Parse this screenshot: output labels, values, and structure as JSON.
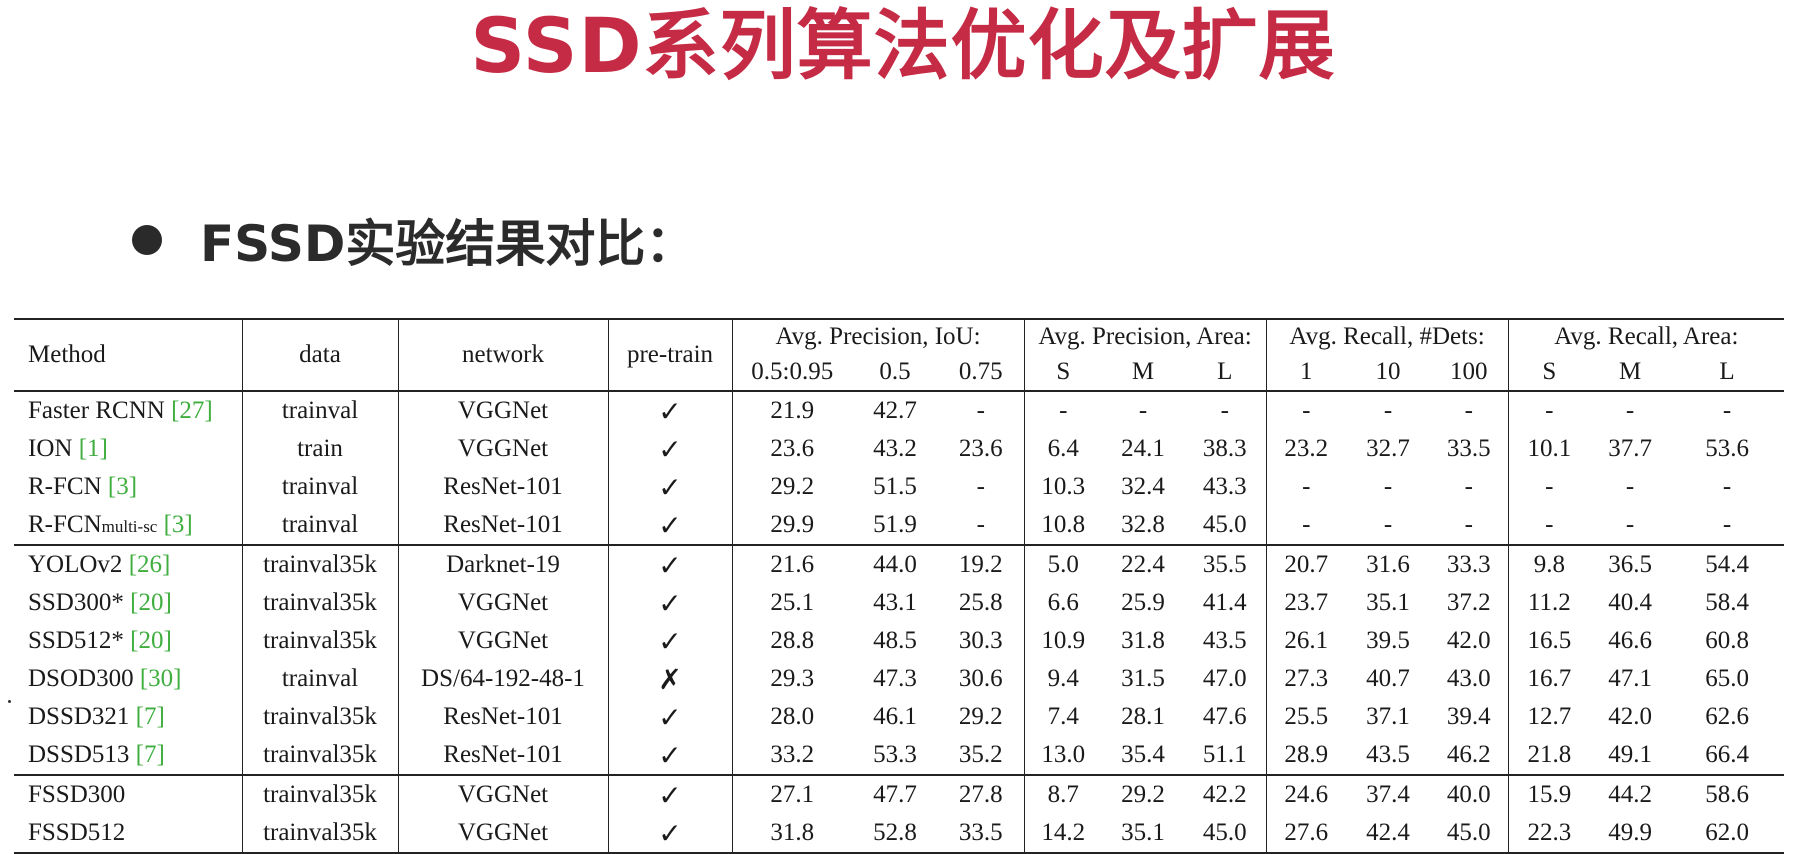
{
  "slide": {
    "title": "SSD系列算法优化及扩展",
    "bullet_text": "FSSD实验结果对比："
  },
  "table": {
    "headers": {
      "method": "Method",
      "data": "data",
      "network": "network",
      "pretrain": "pre-train",
      "group_iou": "Avg. Precision, IoU:",
      "group_area_ap": "Avg. Precision, Area:",
      "group_dets": "Avg. Recall, #Dets:",
      "group_area_ar": "Avg. Recall, Area:",
      "sub": [
        "0.5:0.95",
        "0.5",
        "0.75",
        "S",
        "M",
        "L",
        "1",
        "10",
        "100",
        "S",
        "M",
        "L"
      ]
    },
    "rows": [
      {
        "group": 1,
        "name": "Faster RCNN ",
        "name_sub": "",
        "ref": "[27]",
        "data": "trainval",
        "network": "VGGNet",
        "pretrain": "✓",
        "values": [
          "21.9",
          "42.7",
          "-",
          "-",
          "-",
          "-",
          "-",
          "-",
          "-",
          "-",
          "-",
          "-"
        ],
        "bold": []
      },
      {
        "group": 1,
        "name": "ION ",
        "name_sub": "",
        "ref": "[1]",
        "data": "train",
        "network": "VGGNet",
        "pretrain": "✓",
        "values": [
          "23.6",
          "43.2",
          "23.6",
          "6.4",
          "24.1",
          "38.3",
          "23.2",
          "32.7",
          "33.5",
          "10.1",
          "37.7",
          "53.6"
        ],
        "bold": []
      },
      {
        "group": 1,
        "name": "R-FCN ",
        "name_sub": "",
        "ref": "[3]",
        "data": "trainval",
        "network": "ResNet-101",
        "pretrain": "✓",
        "values": [
          "29.2",
          "51.5",
          "-",
          "10.3",
          "32.4",
          "43.3",
          "-",
          "-",
          "-",
          "-",
          "-",
          "-"
        ],
        "bold": []
      },
      {
        "group": 1,
        "name": "R-FCN",
        "name_sub": "multi-sc",
        "ref": "[3]",
        "data": "trainval",
        "network": "ResNet-101",
        "pretrain": "✓",
        "values": [
          "29.9",
          "51.9",
          "-",
          "10.8",
          "32.8",
          "45.0",
          "-",
          "-",
          "-",
          "-",
          "-",
          "-"
        ],
        "bold": []
      },
      {
        "group": 2,
        "name": "YOLOv2 ",
        "name_sub": "",
        "ref": "[26]",
        "data": "trainval35k",
        "network": "Darknet-19",
        "pretrain": "✓",
        "values": [
          "21.6",
          "44.0",
          "19.2",
          "5.0",
          "22.4",
          "35.5",
          "20.7",
          "31.6",
          "33.3",
          "9.8",
          "36.5",
          "54.4"
        ],
        "bold": []
      },
      {
        "group": 2,
        "name": "SSD300* ",
        "name_sub": "",
        "ref": "[20]",
        "data": "trainval35k",
        "network": "VGGNet",
        "pretrain": "✓",
        "values": [
          "25.1",
          "43.1",
          "25.8",
          "6.6",
          "25.9",
          "41.4",
          "23.7",
          "35.1",
          "37.2",
          "11.2",
          "40.4",
          "58.4"
        ],
        "bold": []
      },
      {
        "group": 2,
        "name": "SSD512* ",
        "name_sub": "",
        "ref": "[20]",
        "data": "trainval35k",
        "network": "VGGNet",
        "pretrain": "✓",
        "values": [
          "28.8",
          "48.5",
          "30.3",
          "10.9",
          "31.8",
          "43.5",
          "26.1",
          "39.5",
          "42.0",
          "16.5",
          "46.6",
          "60.8"
        ],
        "bold": []
      },
      {
        "group": 2,
        "name": "DSOD300 ",
        "name_sub": "",
        "ref": "[30]",
        "data": "trainval",
        "network": "DS/64-192-48-1",
        "pretrain": "✗",
        "values": [
          "29.3",
          "47.3",
          "30.6",
          "9.4",
          "31.5",
          "47.0",
          "27.3",
          "40.7",
          "43.0",
          "16.7",
          "47.1",
          "65.0"
        ],
        "bold": []
      },
      {
        "group": 2,
        "name": "DSSD321 ",
        "name_sub": "",
        "ref": "[7]",
        "data": "trainval35k",
        "network": "ResNet-101",
        "pretrain": "✓",
        "values": [
          "28.0",
          "46.1",
          "29.2",
          "7.4",
          "28.1",
          "47.6",
          "25.5",
          "37.1",
          "39.4",
          "12.7",
          "42.0",
          "62.6"
        ],
        "bold": []
      },
      {
        "group": 2,
        "name": "DSSD513 ",
        "name_sub": "",
        "ref": "[7]",
        "data": "trainval35k",
        "network": "ResNet-101",
        "pretrain": "✓",
        "values": [
          "33.2",
          "53.3",
          "35.2",
          "13.0",
          "35.4",
          "51.1",
          "28.9",
          "43.5",
          "46.2",
          "21.8",
          "49.1",
          "66.4"
        ],
        "bold": [
          0,
          1,
          2,
          4,
          5,
          6,
          7,
          8,
          11
        ]
      },
      {
        "group": 3,
        "name": "FSSD300",
        "name_sub": "",
        "ref": "",
        "data": "trainval35k",
        "network": "VGGNet",
        "pretrain": "✓",
        "values": [
          "27.1",
          "47.7",
          "27.8",
          "8.7",
          "29.2",
          "42.2",
          "24.6",
          "37.4",
          "40.0",
          "15.9",
          "44.2",
          "58.6"
        ],
        "bold": []
      },
      {
        "group": 3,
        "name": "FSSD512",
        "name_sub": "",
        "ref": "",
        "data": "trainval35k",
        "network": "VGGNet",
        "pretrain": "✓",
        "values": [
          "31.8",
          "52.8",
          "33.5",
          "14.2",
          "35.1",
          "45.0",
          "27.6",
          "42.4",
          "45.0",
          "22.3",
          "49.9",
          "62.0"
        ],
        "bold": [
          3,
          9,
          10
        ]
      }
    ]
  },
  "colors": {
    "title": "#c62b45",
    "reference_link": "#3fae3f",
    "text": "#1a1a1a"
  }
}
